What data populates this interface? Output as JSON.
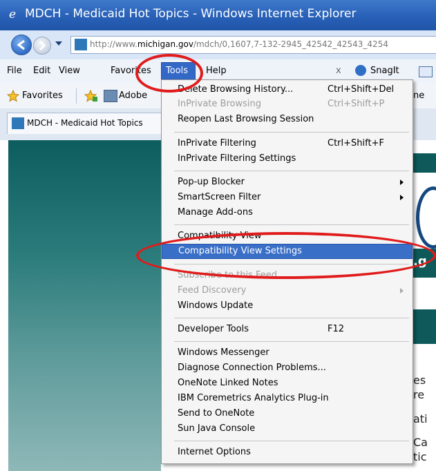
{
  "window": {
    "title": "MDCH - Medicaid Hot Topics - Windows Internet Explorer"
  },
  "address": {
    "prefix": "http://www.",
    "domain": "michigan.gov",
    "rest": "/mdch/0,1607,7-132-2945_42542_42543_4254"
  },
  "menubar": {
    "file": "File",
    "edit": "Edit",
    "view": "View",
    "favorites": "Favorites",
    "tools": "Tools",
    "help": "Help",
    "close_x": "x",
    "snagit": "SnagIt"
  },
  "favbar": {
    "favorites": "Favorites",
    "adobe": "Adobe",
    "ne": "ne"
  },
  "tab": {
    "label": "MDCH - Medicaid Hot Topics"
  },
  "page": {
    "g": ".g",
    "edge_lines": [
      "es",
      "re",
      "ati",
      "Ca",
      "tic"
    ]
  },
  "tools_menu": {
    "items": [
      {
        "label": "Delete Browsing History...",
        "shortcut": "Ctrl+Shift+Del",
        "disabled": false
      },
      {
        "label": "InPrivate Browsing",
        "shortcut": "Ctrl+Shift+P",
        "disabled": true
      },
      {
        "label": "Reopen Last Browsing Session",
        "shortcut": "",
        "disabled": false
      },
      {
        "label": "InPrivate Filtering",
        "shortcut": "Ctrl+Shift+F",
        "disabled": false
      },
      {
        "label": "InPrivate Filtering Settings",
        "shortcut": "",
        "disabled": false
      },
      {
        "label": "Pop-up Blocker",
        "shortcut": "",
        "disabled": false,
        "submenu": true
      },
      {
        "label": "SmartScreen Filter",
        "shortcut": "",
        "disabled": false,
        "submenu": true
      },
      {
        "label": "Manage Add-ons",
        "shortcut": "",
        "disabled": false
      },
      {
        "label": "Compatibility View",
        "shortcut": "",
        "disabled": false
      },
      {
        "label": "Compatibility View Settings",
        "shortcut": "",
        "disabled": false,
        "highlighted": true
      },
      {
        "label": "Subscribe to this Feed...",
        "shortcut": "",
        "disabled": true
      },
      {
        "label": "Feed Discovery",
        "shortcut": "",
        "disabled": true,
        "submenu": true
      },
      {
        "label": "Windows Update",
        "shortcut": "",
        "disabled": false
      },
      {
        "label": "Developer Tools",
        "shortcut": "F12",
        "disabled": false
      },
      {
        "label": "Windows Messenger",
        "shortcut": "",
        "disabled": false
      },
      {
        "label": "Diagnose Connection Problems...",
        "shortcut": "",
        "disabled": false
      },
      {
        "label": "OneNote Linked Notes",
        "shortcut": "",
        "disabled": false
      },
      {
        "label": "IBM Coremetrics Analytics Plug-in",
        "shortcut": "",
        "disabled": false
      },
      {
        "label": "Send to OneNote",
        "shortcut": "",
        "disabled": false
      },
      {
        "label": "Sun Java Console",
        "shortcut": "",
        "disabled": false
      },
      {
        "label": "Internet Options",
        "shortcut": "",
        "disabled": false
      }
    ]
  },
  "colors": {
    "highlight": "#3a6fc8",
    "annotation_ring": "#e01b1b",
    "page_teal": "#0e5a5a"
  }
}
